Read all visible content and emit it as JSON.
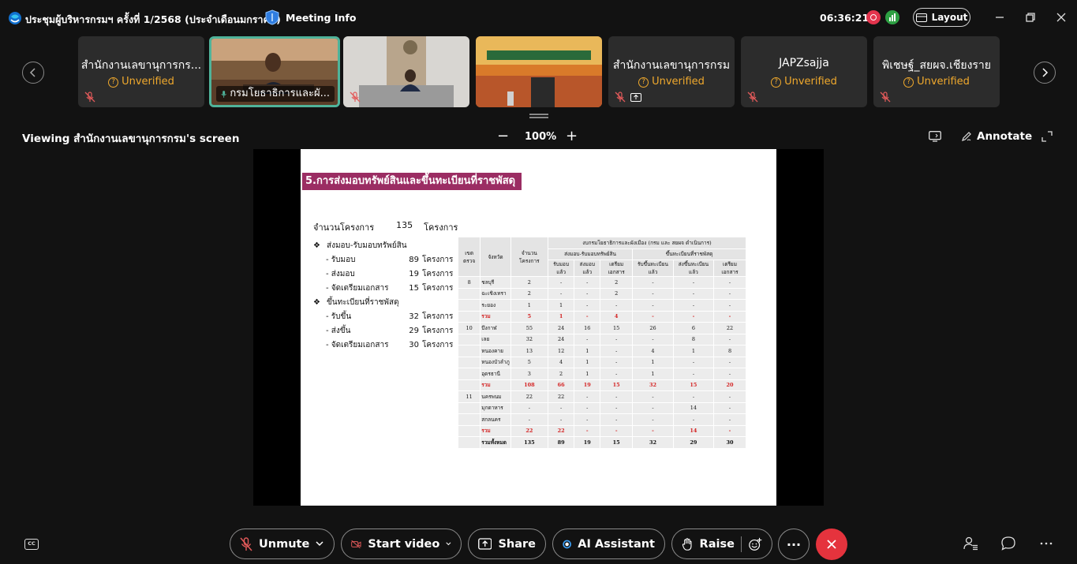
{
  "window": {
    "title": "ประชุมผู้บริหารกรมฯ ครั้งที่ 1/2568 (ประจำเดือนมกราคม)",
    "meeting_info_label": "Meeting Info",
    "clock": "06:36:21",
    "layout_label": "Layout"
  },
  "participants": [
    {
      "name": "สำนักงานเลขานุการกร...",
      "status": "Unverified",
      "muted": true
    },
    {
      "name": "กรมโยธาธิการและผั...",
      "status": "",
      "muted": false,
      "video": true,
      "active": true
    },
    {
      "name": "",
      "status": "",
      "muted": true,
      "video": true
    },
    {
      "name": "",
      "status": "",
      "muted": false,
      "video": true
    },
    {
      "name": "สำนักงานเลขานุการกรม",
      "status": "Unverified",
      "muted": true,
      "sharing": true
    },
    {
      "name": "JAPZsajja",
      "status": "Unverified",
      "muted": true
    },
    {
      "name": "พิเชษฐ์_สยผจ.เชียงราย",
      "status": "Unverified",
      "muted": true
    }
  ],
  "share_bar": {
    "viewing_text": "Viewing สำนักงานเลขานุการกรม's screen",
    "zoom_minus": "−",
    "zoom": "100%",
    "zoom_plus": "+",
    "annotate_label": "Annotate"
  },
  "slide": {
    "title": "5.การส่งมอบทรัพย์สินและขึ้นทะเบียนที่ราชพัสดุ",
    "project_count": {
      "label": "จำนวนโครงการ",
      "value": "135",
      "unit": "โครงการ"
    },
    "bullet_mark": "❖",
    "handover": {
      "heading": "ส่งมอบ-รับมอบทรัพย์สิน",
      "rows": [
        {
          "label": "- รับมอบ",
          "value": "89",
          "unit": "โครงการ"
        },
        {
          "label": "- ส่งมอบ",
          "value": "19",
          "unit": "โครงการ"
        },
        {
          "label": "- จัดเตรียมเอกสาร",
          "value": "15",
          "unit": "โครงการ"
        }
      ]
    },
    "registry": {
      "heading": "ขึ้นทะเบียนที่ราชพัสดุ",
      "rows": [
        {
          "label": "- รับขึ้น",
          "value": "32",
          "unit": "โครงการ"
        },
        {
          "label": "- ส่งขึ้น",
          "value": "29",
          "unit": "โครงการ"
        },
        {
          "label": "- จัดเตรียมเอกสาร",
          "value": "30",
          "unit": "โครงการ"
        }
      ]
    },
    "table": {
      "group_header": "งบกรมโยธาธิการและผังเมือง (กรม และ สยผจ ดำเนินการ)",
      "sub_header_1": "ส่งมอบ-รับมอบทรัพย์สิน",
      "sub_header_2": "ขึ้นทะเบียนที่ราชพัสดุ",
      "col_zone": "เขตตรวจ",
      "col_province": "จังหวัด",
      "col_count": "จำนวนโครงการ",
      "cols": [
        "รับมอบแล้ว",
        "ส่งมอบแล้ว",
        "เตรียมเอกสาร",
        "รับขึ้นทะเบียนแล้ว",
        "ส่งขึ้นทะเบียนแล้ว",
        "เตรียมเอกสาร"
      ],
      "rows": [
        {
          "zone": "8",
          "province": "ชลบุรี",
          "v": [
            "2",
            "-",
            "-",
            "2",
            "-",
            "-",
            "-"
          ],
          "type": ""
        },
        {
          "zone": "",
          "province": "ฉะเชิงเทรา",
          "v": [
            "2",
            "-",
            "-",
            "2",
            "-",
            "-",
            "-"
          ],
          "type": ""
        },
        {
          "zone": "",
          "province": "ระยอง",
          "v": [
            "1",
            "1",
            "-",
            "-",
            "-",
            "-",
            "-"
          ],
          "type": ""
        },
        {
          "zone": "",
          "province": "รวม",
          "v": [
            "5",
            "1",
            "-",
            "4",
            "-",
            "-",
            "-"
          ],
          "type": "sum"
        },
        {
          "zone": "10",
          "province": "บึงกาฬ",
          "v": [
            "55",
            "24",
            "16",
            "15",
            "26",
            "6",
            "22"
          ],
          "type": ""
        },
        {
          "zone": "",
          "province": "เลย",
          "v": [
            "32",
            "24",
            "-",
            "-",
            "-",
            "8",
            "-"
          ],
          "type": ""
        },
        {
          "zone": "",
          "province": "หนองคาย",
          "v": [
            "13",
            "12",
            "1",
            "-",
            "4",
            "1",
            "8"
          ],
          "type": ""
        },
        {
          "zone": "",
          "province": "หนองบัวลำภู",
          "v": [
            "5",
            "4",
            "1",
            "-",
            "1",
            "-",
            "-"
          ],
          "type": ""
        },
        {
          "zone": "",
          "province": "อุดรธานี",
          "v": [
            "3",
            "2",
            "1",
            "-",
            "1",
            "-",
            "-"
          ],
          "type": ""
        },
        {
          "zone": "",
          "province": "รวม",
          "v": [
            "108",
            "66",
            "19",
            "15",
            "32",
            "15",
            "20"
          ],
          "type": "sum"
        },
        {
          "zone": "11",
          "province": "นครพนม",
          "v": [
            "22",
            "22",
            "-",
            "-",
            "-",
            "-",
            "-"
          ],
          "type": ""
        },
        {
          "zone": "",
          "province": "มุกดาหาร",
          "v": [
            "-",
            "-",
            "-",
            "-",
            "-",
            "14",
            "-"
          ],
          "type": ""
        },
        {
          "zone": "",
          "province": "สกลนคร",
          "v": [
            "-",
            "-",
            "-",
            "-",
            "-",
            "-",
            "-"
          ],
          "type": ""
        },
        {
          "zone": "",
          "province": "รวม",
          "v": [
            "22",
            "22",
            "-",
            "-",
            "-",
            "14",
            "-"
          ],
          "type": "sum"
        },
        {
          "zone": "",
          "province": "รวมทั้งหมด",
          "v": [
            "135",
            "89",
            "19",
            "15",
            "32",
            "29",
            "30"
          ],
          "type": "total"
        }
      ]
    }
  },
  "controls": {
    "cc_label": "CC",
    "unmute_label": "Unmute",
    "start_video_label": "Start video",
    "share_label": "Share",
    "ai_label": "AI Assistant",
    "raise_label": "Raise",
    "more_label": "···"
  },
  "colors": {
    "background": "#121212",
    "tile": "#2c2c2c",
    "active_border": "#4fb39a",
    "unverified": "#f0a92c",
    "end_call": "#e5333d",
    "slide_title_bg": "#9b2d63",
    "table_sum": "#d42424"
  }
}
